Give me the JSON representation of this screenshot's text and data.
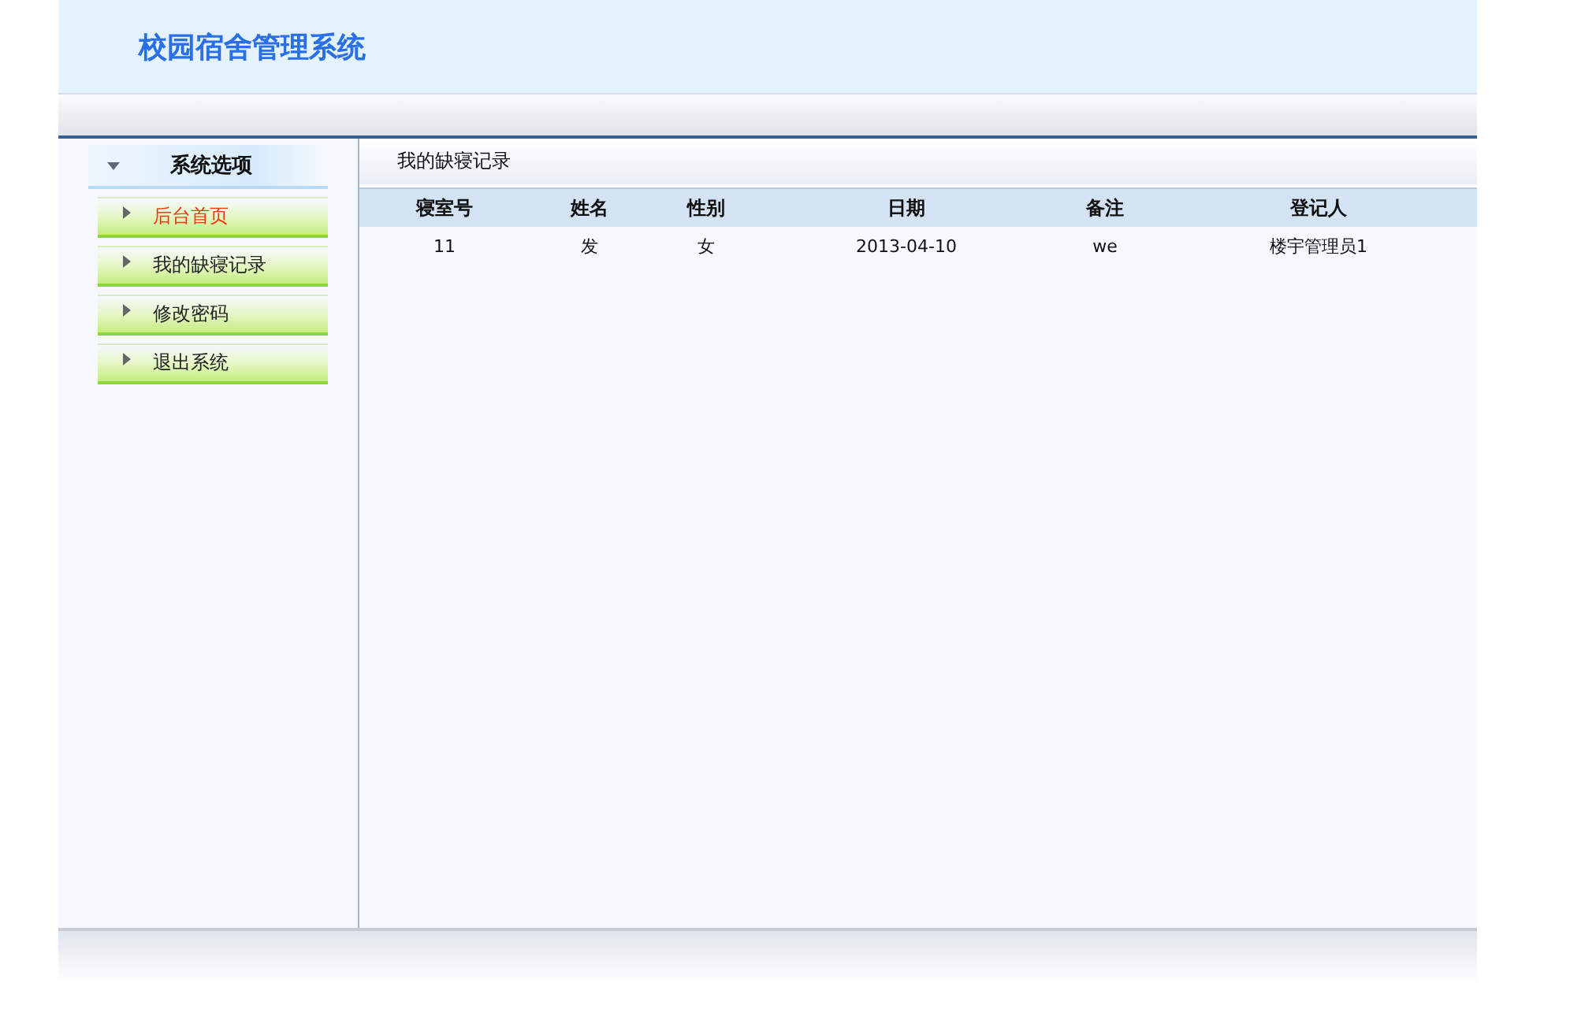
{
  "header": {
    "title": "校园宿舍管理系统"
  },
  "sidebar": {
    "heading": "系统选项",
    "expanded": true,
    "items": [
      {
        "label": "后台首页",
        "selected": true
      },
      {
        "label": "我的缺寝记录",
        "selected": false
      },
      {
        "label": "修改密码",
        "selected": false
      },
      {
        "label": "退出系统",
        "selected": false
      }
    ]
  },
  "content": {
    "title": "我的缺寝记录",
    "table": {
      "columns": [
        "寝室号",
        "姓名",
        "性别",
        "日期",
        "备注",
        "登记人"
      ],
      "rows": [
        [
          "11",
          "发",
          "女",
          "2013-04-10",
          "we",
          "楼宇管理员1"
        ]
      ]
    }
  }
}
